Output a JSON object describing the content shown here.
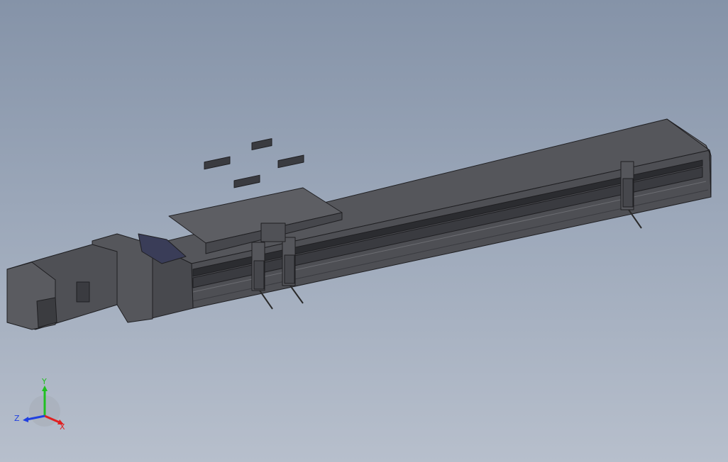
{
  "viewport": {
    "background_top": "#8593a8",
    "background_bottom": "#b7bfcc",
    "model_color": "#5a5b60",
    "edge_color": "#222222"
  },
  "triad": {
    "x_label": "X",
    "y_label": "Y",
    "z_label": "Z",
    "x_color": "#e02020",
    "y_color": "#20c020",
    "z_color": "#2040e0"
  }
}
